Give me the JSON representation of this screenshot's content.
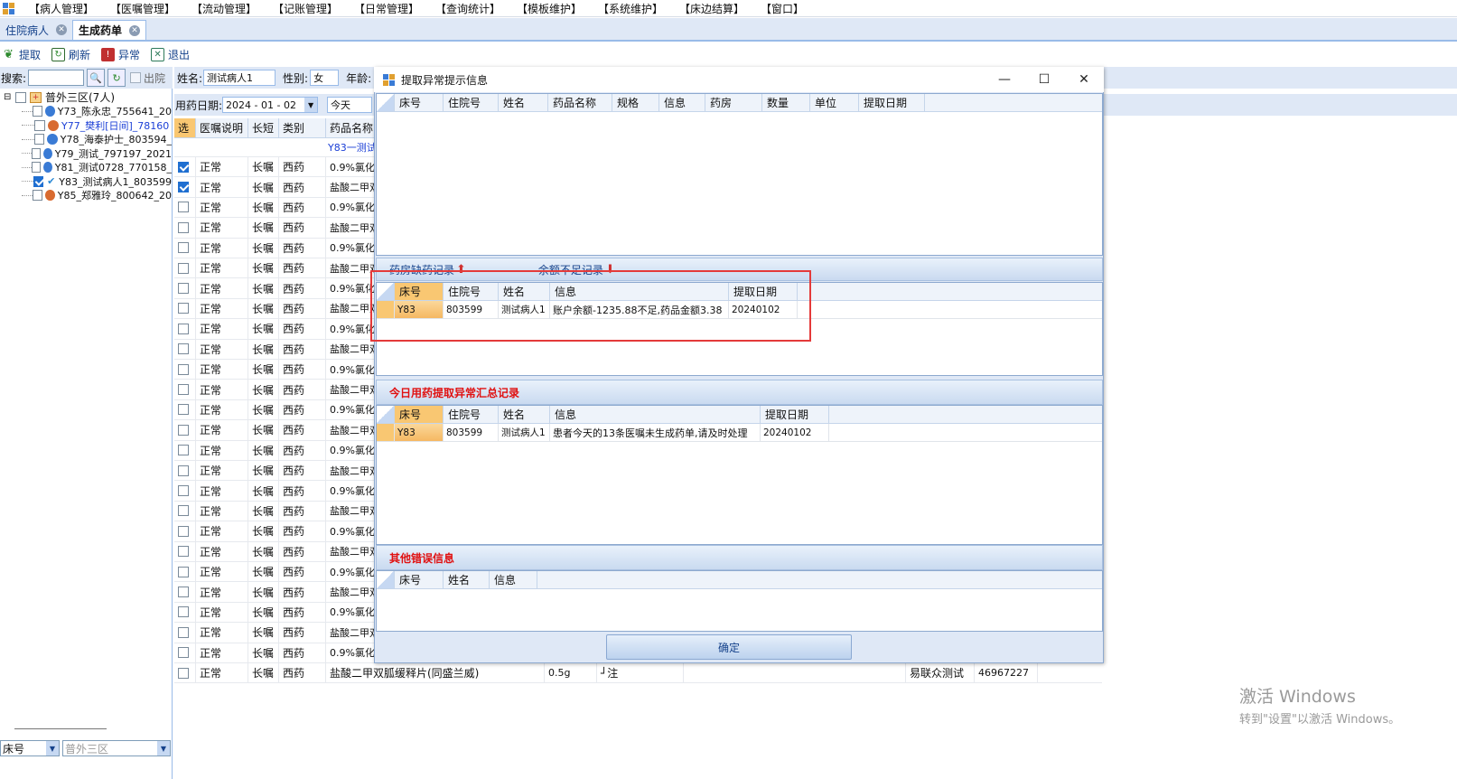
{
  "menu": [
    "【病人管理】",
    "【医嘱管理】",
    "【流动管理】",
    "【记账管理】",
    "【日常管理】",
    "【查询统计】",
    "【模板维护】",
    "【系统维护】",
    "【床边结算】",
    "【窗口】"
  ],
  "tabs": [
    {
      "label": "住院病人",
      "active": false
    },
    {
      "label": "生成药单",
      "active": true
    }
  ],
  "toolbar": {
    "extract": "提取",
    "refresh": "刷新",
    "abnormal": "异常",
    "exit": "退出"
  },
  "search": {
    "label": "搜索:",
    "value": "",
    "discharged_label": "出院"
  },
  "tree": {
    "root": "普外三区(7人)",
    "items": [
      {
        "label": "Y73_陈永忠_755641_20",
        "checked": false,
        "blue": false,
        "female": false
      },
      {
        "label": "Y77_樊利[日间]_78160",
        "checked": false,
        "blue": true,
        "female": true
      },
      {
        "label": "Y78_海泰护士_803594_",
        "checked": false,
        "blue": false,
        "female": false
      },
      {
        "label": "Y79_测试_797197_2021",
        "checked": false,
        "blue": false,
        "female": false
      },
      {
        "label": "Y81_测试0728_770158_",
        "checked": false,
        "blue": false,
        "female": false
      },
      {
        "label": "Y83_测试病人1_803599",
        "checked": true,
        "blue": false,
        "female": false
      },
      {
        "label": "Y85_郑雅玲_800642_20",
        "checked": false,
        "blue": false,
        "female": true
      }
    ]
  },
  "left_bottom": {
    "bed": "床号",
    "ward": "普外三区"
  },
  "patient": {
    "name_label": "姓名:",
    "name": "测试病人1",
    "sex_label": "性别:",
    "sex": "女",
    "age_label": "年龄:"
  },
  "date_row": {
    "label": "用药日期:",
    "date": "2024 - 01 - 02",
    "today": "今天"
  },
  "grid": {
    "headers": [
      "选",
      "医嘱说明",
      "长短",
      "类别",
      "药品名称"
    ],
    "group_row": "Y83一测试",
    "rows_status": "正常",
    "rows_term": "长嘱",
    "rows_type": "西药",
    "drug_a": "0.9%氯化",
    "drug_b": "盐酸二甲双",
    "checked_rows": [
      0,
      1
    ],
    "row_count": 26,
    "last_row": {
      "drug": "盐酸二甲双胍缓释片(同盛兰威)",
      "dose": "0.5g",
      "note": "┘注",
      "doctor": "易联众测试",
      "id": "46967227"
    }
  },
  "dialog": {
    "title": "提取异常提示信息",
    "top_grid_headers": [
      "床号",
      "住院号",
      "姓名",
      "药品名称",
      "规格",
      "信息",
      "药房",
      "数量",
      "单位",
      "提取日期"
    ],
    "sec1_tab_a": "药房缺药记录",
    "sec1_tab_b": "余额不足记录",
    "grid1_headers": [
      "床号",
      "住院号",
      "姓名",
      "信息",
      "提取日期"
    ],
    "grid1_rows": [
      {
        "bed": "Y83",
        "inpatient": "803599",
        "name": "测试病人1",
        "info": "账户余额-1235.88不足,药品金额3.38",
        "date": "20240102"
      }
    ],
    "sec2_title": "今日用药提取异常汇总记录",
    "grid2_headers": [
      "床号",
      "住院号",
      "姓名",
      "信息",
      "提取日期"
    ],
    "grid2_rows": [
      {
        "bed": "Y83",
        "inpatient": "803599",
        "name": "测试病人1",
        "info": "患者今天的13条医嘱未生成药单,请及时处理",
        "date": "20240102"
      }
    ],
    "sec3_title": "其他错误信息",
    "grid3_headers": [
      "床号",
      "姓名",
      "信息"
    ],
    "ok": "确定"
  },
  "watermark": {
    "line1": "激活 Windows",
    "line2": "转到\"设置\"以激活 Windows。"
  },
  "colors": {
    "accent": "#15428b",
    "header_bg": "#dfe8f6",
    "highlight": "#f9c772",
    "alert_red": "#e43a3a"
  }
}
